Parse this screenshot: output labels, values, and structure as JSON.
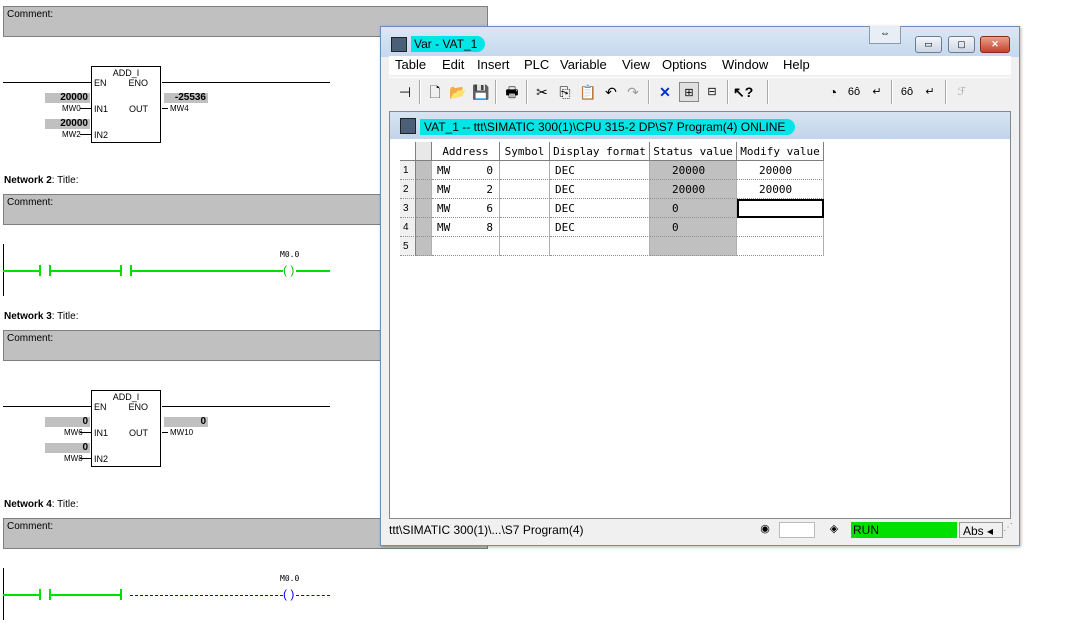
{
  "lad": {
    "comment_label": "Comment:",
    "network_word": "Network",
    "title_suffix": ": Title:",
    "networks": [
      {
        "num": "2"
      },
      {
        "num": "3"
      },
      {
        "num": "4"
      }
    ],
    "blocks": [
      {
        "name": "ADD_I",
        "en": "EN",
        "eno": "ENO",
        "in1": "IN1",
        "in2": "IN2",
        "out": "OUT",
        "in1_value": "20000",
        "in1_operand": "MW0",
        "in2_value": "20000",
        "in2_operand": "MW2",
        "out_value": "-25536",
        "out_operand": "MW4"
      },
      {
        "name": "ADD_I",
        "en": "EN",
        "eno": "ENO",
        "in1": "IN1",
        "in2": "IN2",
        "out": "OUT",
        "in1_value": "0",
        "in1_operand": "MW6",
        "in2_value": "0",
        "in2_operand": "MW8",
        "out_value": "0",
        "out_operand": "MW10"
      }
    ],
    "coil_1": "M0.0",
    "coil_2": "M0.0"
  },
  "window": {
    "title": "Var - VAT_1",
    "restore_glyph": "⇔",
    "min_glyph": "▭",
    "max_glyph": "▢",
    "close_glyph": "✕",
    "menu": [
      "Table",
      "Edit",
      "Insert",
      "PLC",
      "Variable",
      "View",
      "Options",
      "Window",
      "Help"
    ],
    "toolbar_icons": [
      "pin-icon",
      "new-icon",
      "open-icon",
      "save-icon",
      "print-icon",
      "cut-icon",
      "copy-icon",
      "paste-icon",
      "undo-icon",
      "redo-icon",
      "delete-icon",
      "online-icon",
      "monitor-icon",
      "help-icon",
      "trigger-icon",
      "monitor-var-icon",
      "modify-var-icon",
      "monitor-once-icon",
      "modify-once-icon",
      "force-icon"
    ]
  },
  "table": {
    "title": "VAT_1 -- ttt\\SIMATIC 300(1)\\CPU 315-2 DP\\S7 Program(4)  ONLINE",
    "headers": [
      "Address",
      "Symbol",
      "Display format",
      "Status value",
      "Modify value"
    ],
    "rows": [
      {
        "num": "1",
        "area": "MW",
        "offset": "0",
        "symbol": "",
        "format": "DEC",
        "status": "20000",
        "modify": "20000"
      },
      {
        "num": "2",
        "area": "MW",
        "offset": "2",
        "symbol": "",
        "format": "DEC",
        "status": "20000",
        "modify": "20000"
      },
      {
        "num": "3",
        "area": "MW",
        "offset": "6",
        "symbol": "",
        "format": "DEC",
        "status": "0",
        "modify": ""
      },
      {
        "num": "4",
        "area": "MW",
        "offset": "8",
        "symbol": "",
        "format": "DEC",
        "status": "0",
        "modify": ""
      },
      {
        "num": "5",
        "area": "",
        "offset": "",
        "symbol": "",
        "format": "",
        "status": "",
        "modify": ""
      }
    ]
  },
  "statusbar": {
    "path": "ttt\\SIMATIC 300(1)\\...\\S7 Program(4)",
    "run": "RUN",
    "mode": "Abs"
  },
  "colors": {
    "highlight": "#00e6e6",
    "run": "#00e000",
    "status_bg": "#c0c0c0"
  }
}
